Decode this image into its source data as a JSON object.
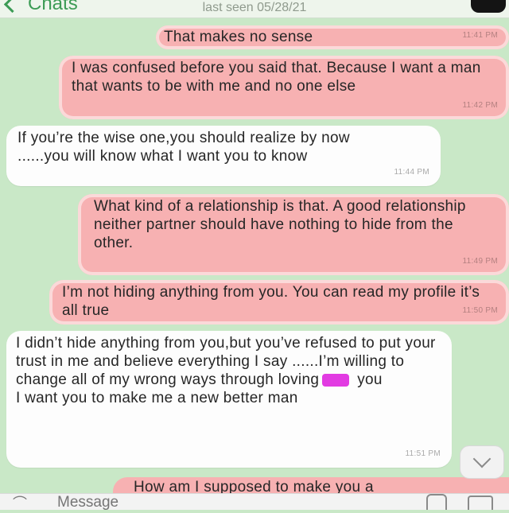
{
  "header": {
    "back_label": "Chats",
    "last_seen": "last seen 05/28/21"
  },
  "messages": [
    {
      "dir": "out",
      "text": "That makes no sense",
      "time": "11:41 PM"
    },
    {
      "dir": "out",
      "text": "I was confused before you said that. Because I want a man that wants to be with me and no one else",
      "time": "11:42 PM"
    },
    {
      "dir": "in",
      "text": "If you’re the wise one,you should realize by now ......you will know what I want you to know",
      "time": "11:44 PM"
    },
    {
      "dir": "out",
      "text": "What kind of a relationship is that. A good relationship neither partner should have nothing to hide from the other.",
      "time": "11:49 PM"
    },
    {
      "dir": "out",
      "text": "I’m not hiding anything from you. You can read my profile it’s all true",
      "time": "11:50 PM"
    },
    {
      "dir": "in",
      "line1": "I didn’t hide anything from you,but you’ve refused to put your trust in me and believe everything I say ......I’m willing to change all of my wrong ways through loving",
      "line1_end": "you",
      "line2": "I want you to make me a new better man",
      "time": "11:51 PM"
    }
  ],
  "peek_text": "How am I supposed to make you a",
  "input": {
    "placeholder": "Message"
  },
  "colors": {
    "background": "#c9e8c7",
    "outgoing": "#f7b1b2",
    "incoming": "#fdfdfd",
    "accent": "#3c9b55"
  },
  "icons": [
    "chevron-left-icon",
    "attachment-icon",
    "sticker-icon",
    "camera-icon",
    "chevron-down-icon"
  ]
}
